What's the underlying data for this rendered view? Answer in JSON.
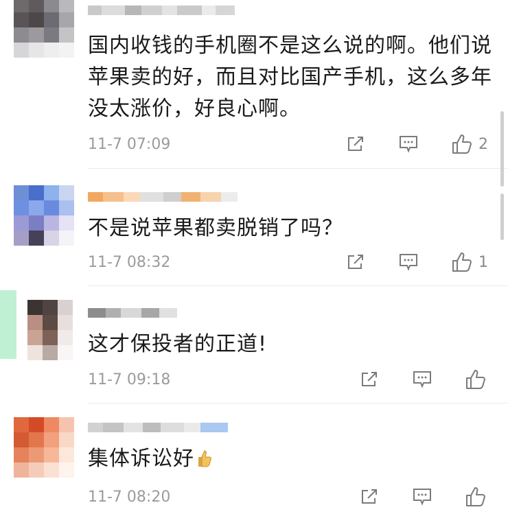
{
  "comments": [
    {
      "text": "国内收钱的手机圈不是这么说的啊。他们说苹果卖的好，而且对比国产手机，这么多年没太涨价，好良心啊。",
      "time": "11-7 07:09",
      "likes": "2",
      "avatar_colors": [
        "#6d6a6b",
        "#5f5a5d",
        "#8b8a8e",
        "#b9b8bd",
        "#5a5457",
        "#4d474a",
        "#6c6a72",
        "#a7a6ab",
        "#8d8a90",
        "#9c999f",
        "#7c7a80",
        "#c4c3c6",
        "#d6d5d8",
        "#e6e5e7",
        "#eeeeef",
        "#f3f3f4"
      ]
    },
    {
      "text": "不是说苹果都卖脱销了吗？",
      "time": "11-7 08:32",
      "likes": "1",
      "avatar_colors": [
        "#6e8fd6",
        "#4a6fca",
        "#8fb1ec",
        "#c8d6f2",
        "#6f90e0",
        "#8aa8ec",
        "#6a8ae0",
        "#aac0ee",
        "#9c9ad6",
        "#7c7ec4",
        "#b9b6e2",
        "#e4e2f4",
        "#a59fc8",
        "#464058",
        "#d8d4e6",
        "#f4f3f8"
      ]
    },
    {
      "text": "这才保投者的正道!",
      "time": "11-7 09:18",
      "likes": "",
      "avatar_colors": [
        "#ffffff",
        "#3b3431",
        "#4f4442",
        "#d9d1cf",
        "#ffffff",
        "#b98f84",
        "#5d4a43",
        "#e8dedc",
        "#ffffff",
        "#caa394",
        "#7c6257",
        "#f0eae8",
        "#ffffff",
        "#efe3de",
        "#b8aaa4",
        "#f9f6f5"
      ]
    },
    {
      "text": "集体诉讼好",
      "time": "11-7 08:20",
      "likes": "",
      "avatar_colors": [
        "#e0683f",
        "#d44b28",
        "#ee8a62",
        "#f6c4ae",
        "#d45a33",
        "#e2764c",
        "#f2a07d",
        "#fad8c8",
        "#e6825c",
        "#ec9a76",
        "#f6b897",
        "#fde7dd",
        "#f0b49c",
        "#f5ccba",
        "#fbe0d4",
        "#fff3ed"
      ]
    }
  ],
  "icons": {
    "share": "share-icon",
    "comment": "comment-icon",
    "like": "like-icon",
    "emoji": "thumbs-up-emoji"
  }
}
